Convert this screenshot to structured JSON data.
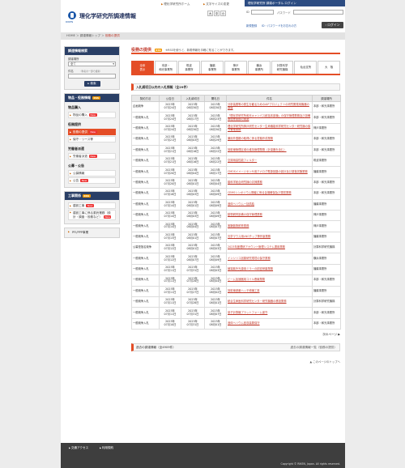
{
  "header": {
    "site_title": "理化学研究所調達情報",
    "logo_sub": "RIKEN",
    "links": {
      "home": "理化学研究所ホーム",
      "fontsize": "文字サイズの変更"
    },
    "font_sizes": [
      "大",
      "中",
      "小"
    ]
  },
  "login": {
    "bar_text": "理化学研究所 調達ポータル ログイン",
    "id_label": "ID",
    "password_label": "パスワード",
    "register_link": "新規登録",
    "forgot_link": "ID・パスワードをお忘れの方",
    "button": "ログイン"
  },
  "breadcrumb": {
    "home": "HOME",
    "sep": " ＞ ",
    "level1": "調達情報トップ",
    "current": "役務の提供"
  },
  "sidebar": {
    "search": {
      "title": "調達情報検索",
      "place_label": "調達場所",
      "place_value": "全て",
      "keyword_label": "件名",
      "keyword_note": "（件名の一部で検索）",
      "button": "検索"
    },
    "goods": {
      "title": "物品・役務情報",
      "rss": "RSS",
      "section": "物品購入",
      "items": [
        {
          "label": "物品の購入",
          "new": "New"
        }
      ],
      "section2": "役務提供",
      "items2": [
        {
          "label": "役務の提供",
          "new": "New"
        },
        {
          "label": "保守・リース等"
        }
      ],
      "section3": "労働者派遣",
      "items3": [
        {
          "label": "労働者派遣",
          "new": "New"
        }
      ],
      "section4": "公募・公告",
      "items4": [
        {
          "label": "公募情報"
        },
        {
          "label": "公告",
          "new": "New"
        }
      ]
    },
    "construction": {
      "title": "工事関係",
      "rss": "RSS",
      "items": [
        {
          "label": "建設工事",
          "new": "New"
        },
        {
          "label": "建設工事に係る委託業務（設計・調査・役務など）",
          "new": "New"
        }
      ],
      "pfi": "PFI/PPP事業"
    }
  },
  "main": {
    "title": "役務の提供",
    "rss": "RSS",
    "desc": "※RSSを使うと、新着情報を手軽に知ることができます。",
    "tabs": [
      "全体\n表示",
      "本部・\n和光事業所",
      "筑波\n事業所",
      "播磨\n事業所",
      "神戸\n事業所",
      "横浜\n事業所",
      "計算科学\n研究機構",
      "仙台支所",
      "大　阪"
    ],
    "table_heading": "入札締切日以内の入札情報（全29件）",
    "columns": [
      "契約方法",
      "公告日",
      "入札締切日",
      "開札日",
      "件名",
      "調達場所"
    ],
    "rows": [
      {
        "method": "企画競争",
        "pub": "2023年\n07月24日",
        "deadline": "2023年\n08月30日",
        "open": "2023年\n08月30日",
        "subject": "分析装置等の発生を観るためのAIPプロジェクトの研究開発用機器の調達",
        "place": "本部・和光事業所"
      },
      {
        "method": "一般競争入札",
        "pub": "2023年\n07月24日",
        "deadline": "2023年\n08月17日",
        "open": "2023年\n08月23日",
        "subject": "「理化学研究所和光キャンパス統括本部棟」の保守管理業務及び設備管理等業務の実施",
        "place": "本部・和光事業所"
      },
      {
        "method": "一般競争入札",
        "pub": "2023年\n07月24日",
        "deadline": "2023年\n08月30日",
        "open": "2023年\n08月30日",
        "subject": "理化学研究所神戸研究センター生命機能科学研究センター研究棟の保守管理業務",
        "place": "神戸事業所"
      },
      {
        "method": "一般競争入札",
        "pub": "2023年\n07月21日",
        "deadline": "2023年\n08月03日",
        "open": "2023年\n08月29日",
        "subject": "兼用外国籍の取得に係る書類作成業務",
        "place": "本部・和光事業所"
      },
      {
        "method": "一般競争入札",
        "pub": "2023年\n07月21日",
        "deadline": "2023年\n08月16日",
        "open": "2023年\n08月22日",
        "subject": "放射線管理区域の維持管理業務（計量器を含む）",
        "place": "本部・和光事業所"
      },
      {
        "method": "一般競争入札",
        "pub": "2023年\n07月21日",
        "deadline": "2023年\n08月16日",
        "open": "2023年\n08月22日",
        "subject": "空調用高性能フィルター",
        "place": "筑波事業所"
      },
      {
        "method": "一般競争入札",
        "pub": "2023年\n07月20日",
        "deadline": "2023年\n08月04日",
        "open": "2023年\n08月17日",
        "subject": "CMOSイメージセンサ用アナログ電源回路の設計及び調査試験業務",
        "place": "播磨事業所"
      },
      {
        "method": "一般競争入札",
        "pub": "2023年\n07月20日",
        "deadline": "2023年\n08月01日",
        "open": "2023年\n08月04日",
        "subject": "脳科学総合研究棟の清掃業務",
        "place": "本部・和光事業所"
      },
      {
        "method": "一般競争入札",
        "pub": "2023年\n07月18日",
        "deadline": "2023年\n08月03日",
        "open": "2023年\n08月09日",
        "subject": "CEMSシンポジウム開催に係る会場確保及び運営業務",
        "place": "本部・和光事業所"
      },
      {
        "method": "一般競争入札",
        "pub": "2023年\n07月14日",
        "deadline": "2023年\n08月01日",
        "open": "2023年\n08月09日",
        "subject": "液体ヘリウム一括供給",
        "place": "播磨事業所"
      },
      {
        "method": "一般競争入札",
        "pub": "2023年\n07月14日",
        "deadline": "2023年\n08月03日",
        "open": "2023年\n08月09日",
        "subject": "動物飼育設備の保守管理業務",
        "place": "神戸事業所"
      },
      {
        "method": "一般競争入札",
        "pub": "2023年\n07月14日",
        "deadline": "2023年\n08月04日",
        "open": "2023年\n08月07日",
        "subject": "実験動物飼育業務",
        "place": "神戸事業所"
      },
      {
        "method": "一般競争入札",
        "pub": "2023年\n07月13日",
        "deadline": "2023年\n08月01日",
        "open": "2023年\n08月07日",
        "subject": "光学マウス用LNOチップ等作製業務",
        "place": "播磨事業所"
      },
      {
        "method": "公募型指名競争",
        "pub": "2023年\n07月12日",
        "deadline": "2023年\n08月01日",
        "open": "2023年\n08月03日",
        "subject": "2023年度理研アカウント管理システム運用業務",
        "place": "計算科学研究機構"
      },
      {
        "method": "一般競争入札",
        "pub": "2023年\n07月12日",
        "deadline": "2023年\n08月07日",
        "open": "2023年\n08月09日",
        "subject": "インシリコ創薬研究環境の保守業務",
        "place": "横浜事業所"
      },
      {
        "method": "一般競争入札",
        "pub": "2023年\n07月11日",
        "deadline": "2023年\n07月31日",
        "open": "2023年\n08月03日",
        "subject": "極端紫外光源用ミラーの精密研磨業務",
        "place": "播磨事業所"
      },
      {
        "method": "一般競争入札",
        "pub": "2023年\n07月11日",
        "deadline": "2023年\n07月28日",
        "open": "2023年\n08月04日",
        "subject": "ビーム加速器用コイル巻線業務",
        "place": "本部・和光事業所"
      },
      {
        "method": "一般競争入札",
        "pub": "2023年\n07月11日",
        "deadline": "2023年\n07月27日",
        "open": "2023年\n08月02日",
        "subject": "放射線遮蔽ハッチ修繕工事",
        "place": "播磨事業所"
      },
      {
        "method": "一般競争入札",
        "pub": "2023年\n07月11日",
        "deadline": "2023年\n07月28日",
        "open": "2023年\n08月01日",
        "subject": "統合生命医科学研究センター研究機器の移設業務",
        "place": "計算科学研究機構"
      },
      {
        "method": "一般競争入札",
        "pub": "2023年\n07月11日",
        "deadline": "2023年\n07月31日",
        "open": "2023年\n08月07日",
        "subject": "量子計算機プラットフォーム保守",
        "place": "本部・和光事業所"
      },
      {
        "method": "一般競争入札",
        "pub": "2023年\n07月10日",
        "deadline": "2023年\n07月31日",
        "open": "2023年\n08月01日",
        "subject": "液体ヘリウム回収装置保守",
        "place": "本部・和光事業所"
      }
    ],
    "next_link": "次のページ ▶",
    "past_heading": "過去の調達情報（全4909件）",
    "past_link": "過去の調達情報一覧（役務の提供）",
    "page_top": "▲ このページのトップへ"
  },
  "footer": {
    "links": [
      "交通アクセス",
      "利用規約"
    ],
    "copyright": "Copyright © RIKEN, Japan. All rights reserved."
  }
}
